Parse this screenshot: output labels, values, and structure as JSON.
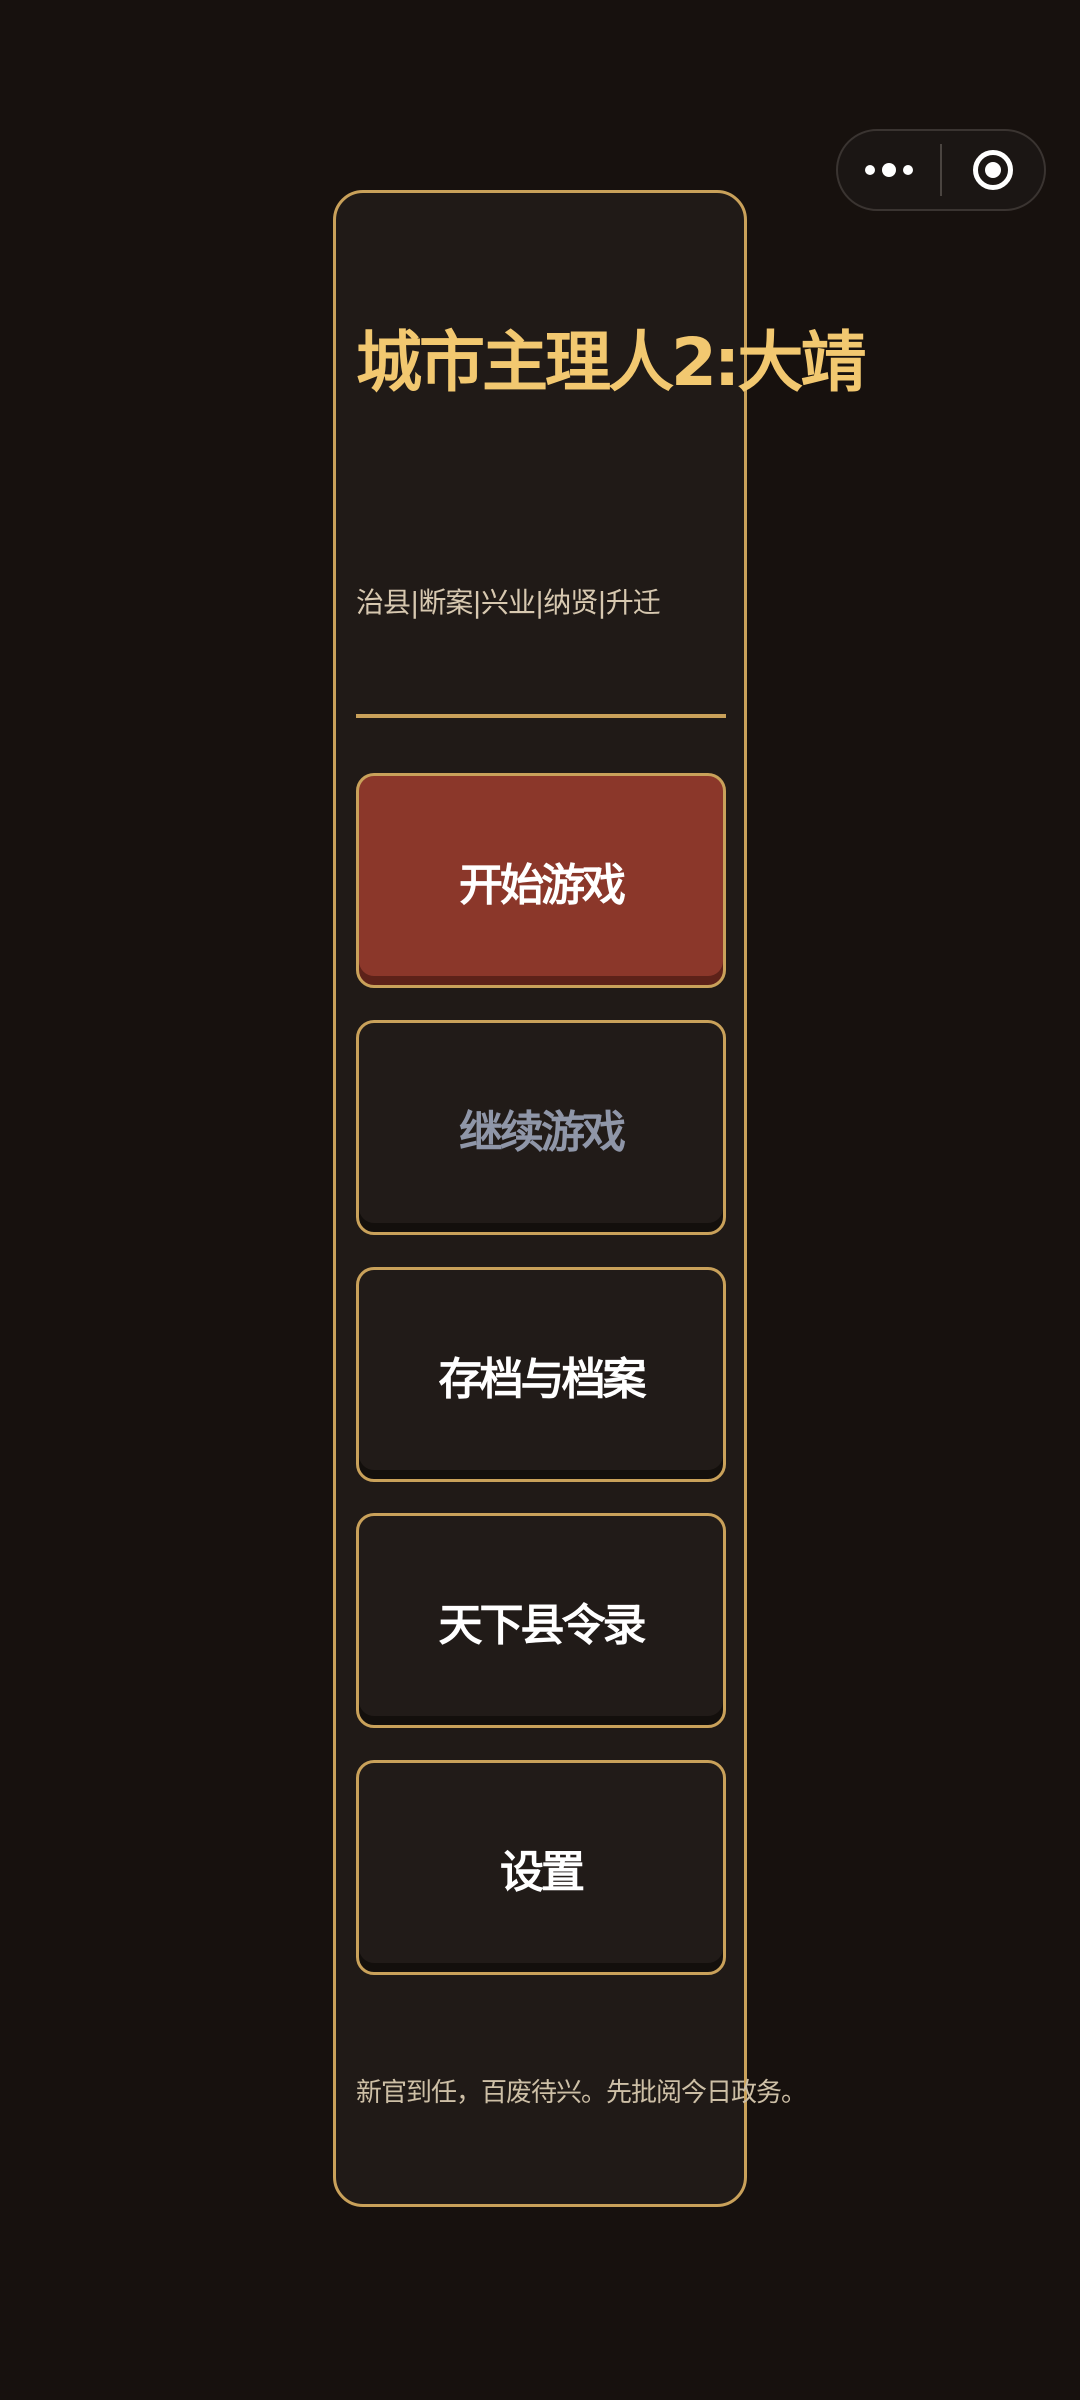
{
  "capsule": {
    "more_icon": "more-dots-icon",
    "close_icon": "target-close-icon"
  },
  "card": {
    "title": "城市主理人2:大靖",
    "subtitle": "治县|断案|兴业|纳贤|升迁",
    "buttons": {
      "start": "开始游戏",
      "continue": "继续游戏",
      "archive": "存档与档案",
      "roster": "天下县令录",
      "settings": "设置"
    },
    "footer": "新官到任，百废待兴。先批阅今日政务。"
  },
  "colors": {
    "background": "#17110e",
    "card": "#201a17",
    "gold": "#c9a15a",
    "title": "#f2c870",
    "primary": "#8b372a",
    "disabled_text": "#8f96a8"
  }
}
